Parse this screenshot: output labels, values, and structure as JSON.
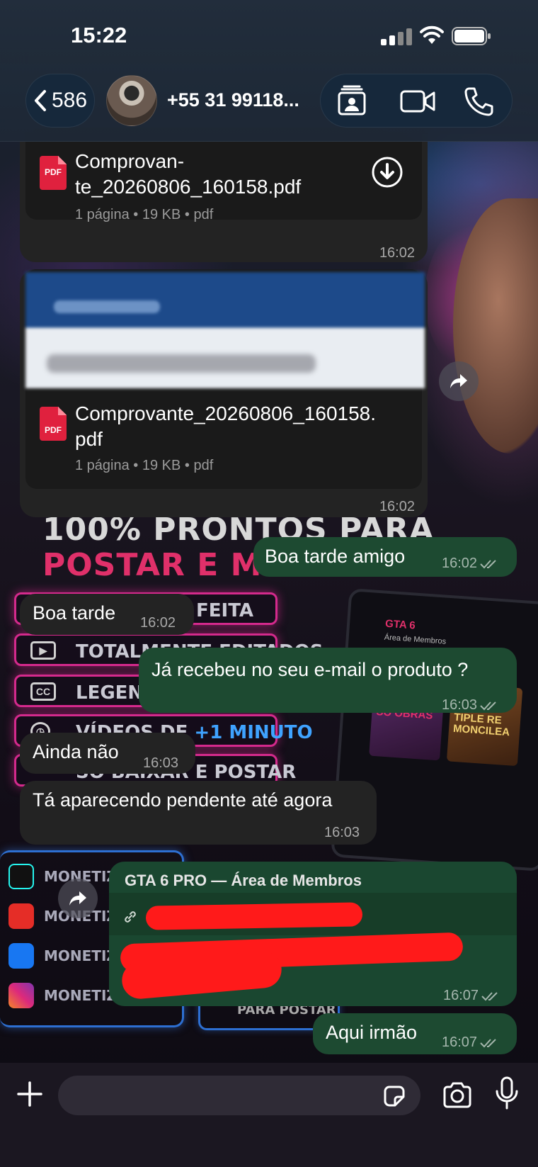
{
  "status_bar": {
    "time": "15:22"
  },
  "header": {
    "back_count": "586",
    "contact_name": "+55 31 99118..."
  },
  "wallpaper": {
    "headline_1": "100% PRONTOS PARA",
    "headline_2": "POSTAR E MO",
    "pill_1": "FEITA",
    "pill_2": "TOTALMENTE EDITADOS",
    "pill_3": "LEGENDA",
    "pill_4_a": "VÍDEOS DE ",
    "pill_4_b": "+1 MINUTO",
    "pill_5": "SÓ BAIXAR E POSTAR",
    "laptop_title": "GTA 6",
    "laptop_subtitle": "Área de Membros",
    "laptop_card_1": "SÓ OBRAS",
    "laptop_card_2": "TIPLE RE MONCILEA",
    "social_1": "MONETIZE N",
    "social_2": "MONETIZE N",
    "social_3": "MONETIZE N",
    "social_4": "MONETIZE N",
    "bottom_btn": "PARA POSTAR"
  },
  "messages": {
    "doc1": {
      "name_line1": "Comprovan-",
      "name_line2": "te_20260806_160158.pdf",
      "meta": "1 página • 19 KB • pdf",
      "icon_label": "PDF",
      "time": "16:02"
    },
    "doc2": {
      "name_line1": "Comprovante_20260806_160158.",
      "name_line2": "pdf",
      "meta": "1 página • 19 KB • pdf",
      "icon_label": "PDF",
      "time": "16:02"
    },
    "out1": {
      "text": "Boa  tarde amigo",
      "time": "16:02"
    },
    "in1": {
      "text": "Boa tarde",
      "time": "16:02"
    },
    "out2": {
      "text": "Já recebeu no seu e-mail o produto ?",
      "time": "16:03"
    },
    "in2": {
      "text": "Ainda não",
      "time": "16:03"
    },
    "in3": {
      "text": "Tá aparecendo pendente até agora",
      "time": "16:03"
    },
    "out3": {
      "link_title": "GTA 6 PRO — Área de Membros",
      "time": "16:07"
    },
    "out4": {
      "text": "Aqui irmão",
      "time": "16:07"
    }
  },
  "input": {
    "placeholder": ""
  },
  "colors": {
    "incoming_bubble": "#232323",
    "outgoing_bubble": "#1d4a31",
    "redaction": "#ff1a1a",
    "pdf_icon": "#e0213e"
  },
  "icons": [
    "chevron-left-icon",
    "contact-card-icon",
    "video-icon",
    "phone-icon",
    "download-icon",
    "forward-icon",
    "link-icon",
    "double-check-icon",
    "plus-icon",
    "sticker-icon",
    "camera-icon",
    "microphone-icon"
  ]
}
